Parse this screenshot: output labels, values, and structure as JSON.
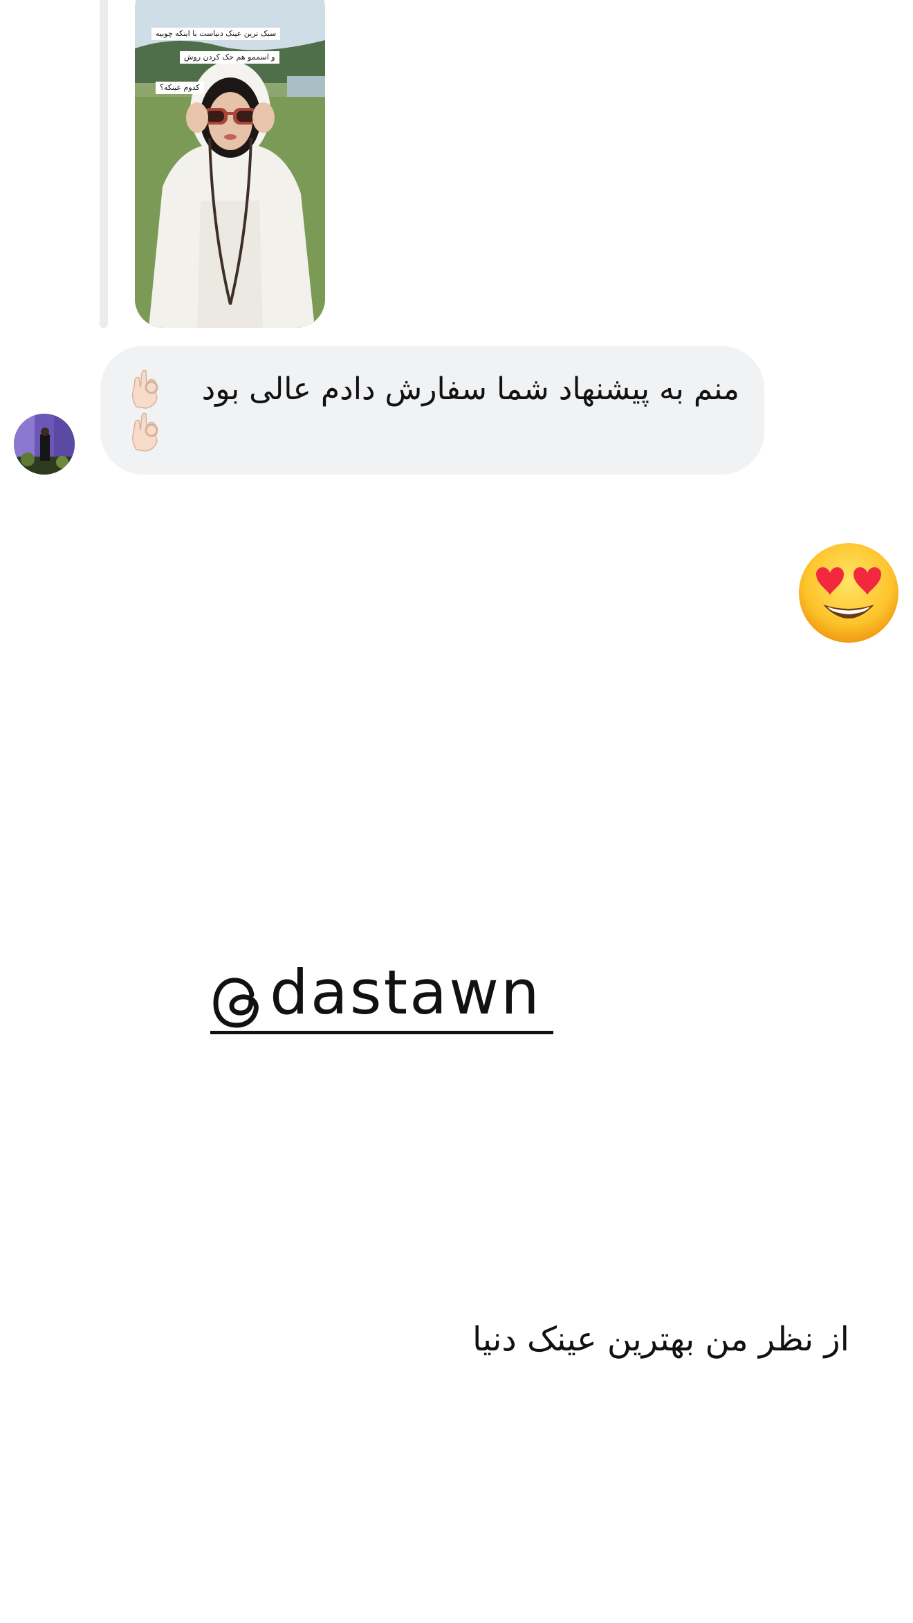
{
  "story_reply": {
    "captions": [
      "سبک ترین عینک دنیاست با اینکه چوبیه",
      "و اسممو هم حک کردن روش",
      "کدوم عینکه؟"
    ],
    "reply_bar_color": "#ececef"
  },
  "message": {
    "text": "منم به پیشنهاد شما سفارش دادم عالی بود",
    "emoji_icons": [
      "ok-hand-icon",
      "ok-hand-icon"
    ],
    "bubble_color": "#f1f2f4"
  },
  "reaction": {
    "emoji_icon": "heart-eyes-emoji-icon"
  },
  "handle": {
    "icon": "threads-icon",
    "text": "dastawn"
  },
  "bottom_text": "از نظر من بهترین عینک دنیا"
}
